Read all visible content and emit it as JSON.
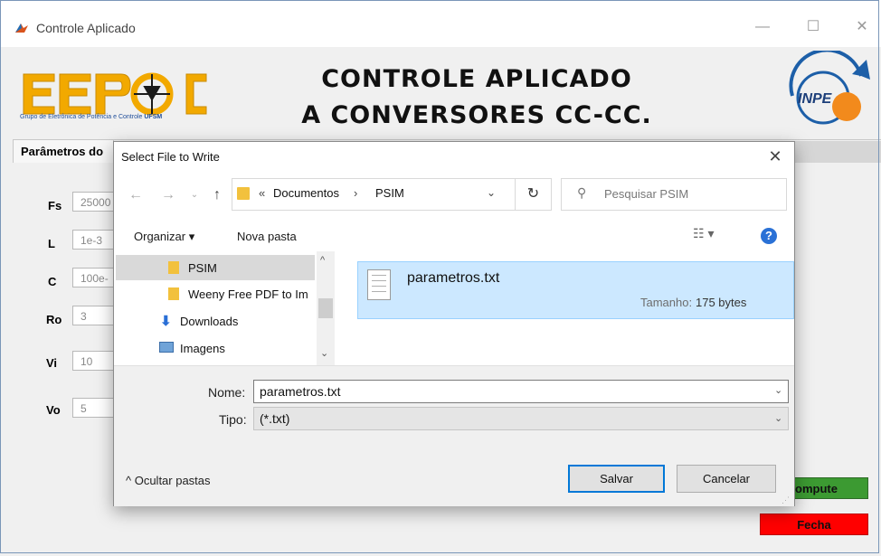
{
  "window": {
    "title": "Controle Aplicado",
    "minimize_glyph": "—",
    "maximize_glyph": "☐",
    "close_glyph": "✕"
  },
  "header": {
    "logo_subtitle": "Grupo de Eletrônica de Potência e Controle",
    "logo_subtitle_bold": "UFSM",
    "title_line1": "CONTROLE APLICADO",
    "title_line2": "A CONVERSORES CC-CC.",
    "inpe_logo_text": "INPE"
  },
  "panel": {
    "tab_label": "Parâmetros do",
    "params": [
      {
        "label": "Fs",
        "value": "25000"
      },
      {
        "label": "L",
        "value": "1e-3"
      },
      {
        "label": "C",
        "value": "100e-"
      },
      {
        "label": "Ro",
        "value": "3"
      },
      {
        "label": "Vi",
        "value": "10"
      },
      {
        "label": "Vo",
        "value": "5"
      }
    ],
    "compute_label": "ompute",
    "close_label": "Fecha",
    "compute_color": "#3c9a32",
    "close_color": "#ff0000"
  },
  "dialog": {
    "title": "Select File to Write",
    "close_glyph": "✕",
    "address": {
      "overflow": "«",
      "crumbs": [
        "Documentos",
        "PSIM"
      ],
      "separator": "›"
    },
    "search_placeholder": "Pesquisar PSIM",
    "toolbar": {
      "organize_label": "Organizar ▾",
      "new_folder_label": "Nova pasta",
      "view_glyph": "☷ ▾",
      "help_glyph": "?"
    },
    "nav_items": [
      {
        "label": "PSIM",
        "icon": "folder-icon",
        "selected": true
      },
      {
        "label": "Weeny Free PDF to Im",
        "icon": "folder-icon",
        "selected": false
      },
      {
        "label": "Downloads",
        "icon": "download-arrow-icon",
        "selected": false
      },
      {
        "label": "Imagens",
        "icon": "pictures-icon",
        "selected": false
      }
    ],
    "file": {
      "name": "parametros.txt",
      "size_label": "Tamanho:",
      "size_value": "175 bytes"
    },
    "form": {
      "name_label": "Nome:",
      "name_value": "parametros.txt",
      "type_label": "Tipo:",
      "type_value": "(*.txt)"
    },
    "hide_folders_label": "^ Ocultar pastas",
    "save_label": "Salvar",
    "cancel_label": "Cancelar",
    "accent_color": "#0078d7",
    "selection_color": "#cce8ff"
  }
}
